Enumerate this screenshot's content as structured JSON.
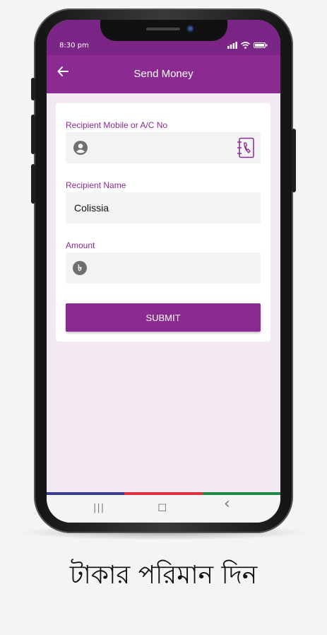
{
  "status_bar": {
    "time": "8:30 pm",
    "icons": [
      "signal-icon",
      "wifi-icon",
      "battery-icon"
    ]
  },
  "app_bar": {
    "back_icon": "arrow-left-icon",
    "title": "Send Money"
  },
  "form": {
    "recipient_mobile": {
      "label": "Recipient Mobile or A/C No",
      "value": "",
      "leading_icon": "person-icon",
      "trailing_icon": "contact-book-icon"
    },
    "recipient_name": {
      "label": "Recipient Name",
      "value": "Colissia"
    },
    "amount": {
      "label": "Amount",
      "value": "",
      "leading_icon": "taka-icon",
      "icon_glyph": "৳"
    },
    "submit_label": "SUBMIT"
  },
  "nav_bar": {
    "recents": "|||",
    "home": "◻",
    "back": "‹",
    "icons": [
      "recents-icon",
      "home-icon",
      "back-nav-icon"
    ]
  },
  "accent_lines": [
    "#3b3d8f",
    "#d9313d",
    "#1f8a48"
  ],
  "colors": {
    "primary": "#8b2b91",
    "status": "#7b2586",
    "background": "#f3e9f3"
  },
  "caption": "টাকার পরিমান দিন"
}
